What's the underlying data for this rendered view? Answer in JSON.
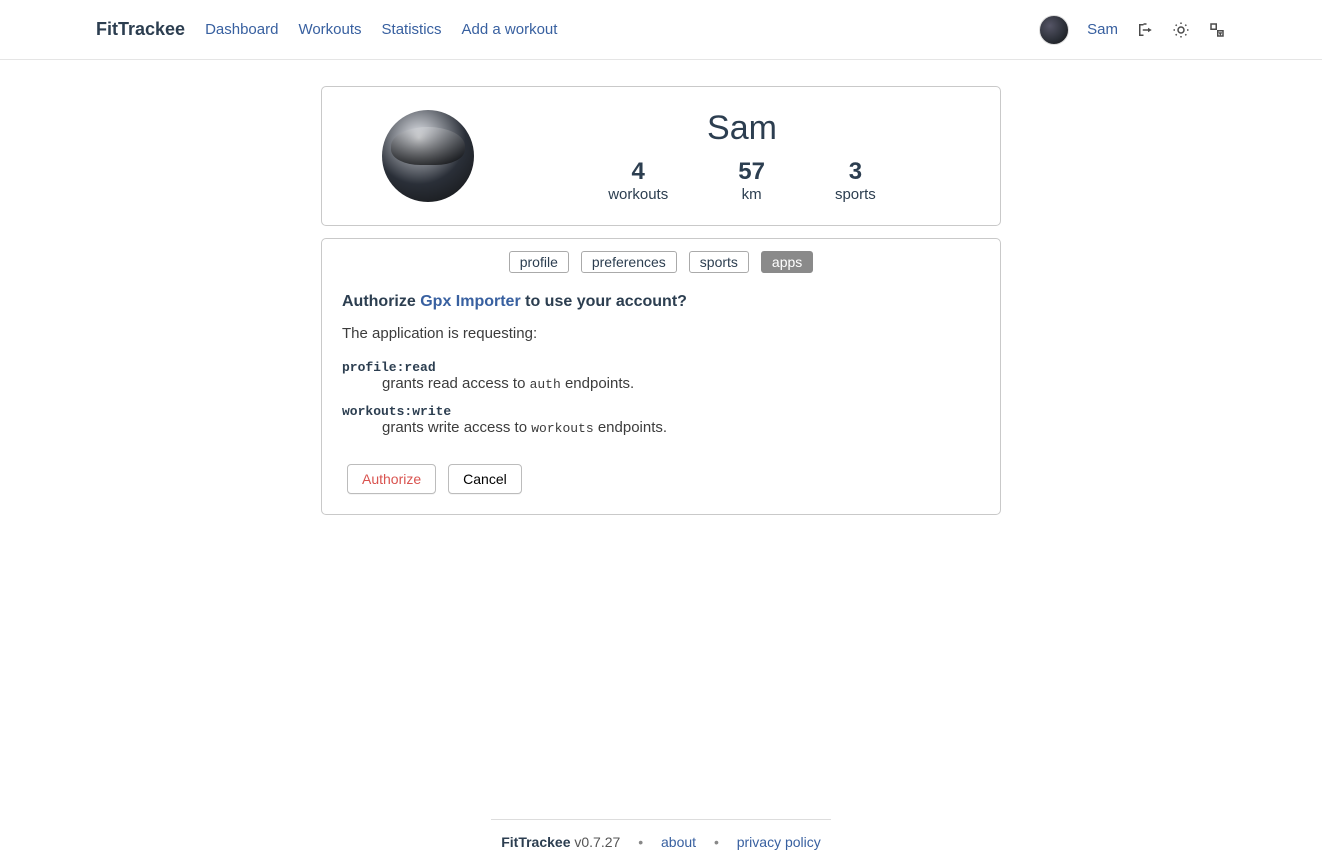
{
  "nav": {
    "brand": "FitTrackee",
    "links": [
      "Dashboard",
      "Workouts",
      "Statistics",
      "Add a workout"
    ],
    "user": "Sam"
  },
  "profile": {
    "name": "Sam",
    "stats": [
      {
        "value": "4",
        "label": "workouts"
      },
      {
        "value": "57",
        "label": "km"
      },
      {
        "value": "3",
        "label": "sports"
      }
    ]
  },
  "tabs": [
    "profile",
    "preferences",
    "sports",
    "apps"
  ],
  "active_tab": "apps",
  "auth": {
    "prefix": "Authorize ",
    "app_name": "Gpx Importer",
    "suffix": " to use your account?",
    "subtext": "The application is requesting:",
    "scopes": [
      {
        "name": "profile:read",
        "desc_pre": "grants read access to ",
        "desc_code": "auth",
        "desc_post": " endpoints."
      },
      {
        "name": "workouts:write",
        "desc_pre": "grants write access to ",
        "desc_code": "workouts",
        "desc_post": " endpoints."
      }
    ],
    "authorize_label": "Authorize",
    "cancel_label": "Cancel"
  },
  "footer": {
    "brand": "FitTrackee",
    "version": " v0.7.27",
    "about": "about",
    "privacy": "privacy policy"
  }
}
